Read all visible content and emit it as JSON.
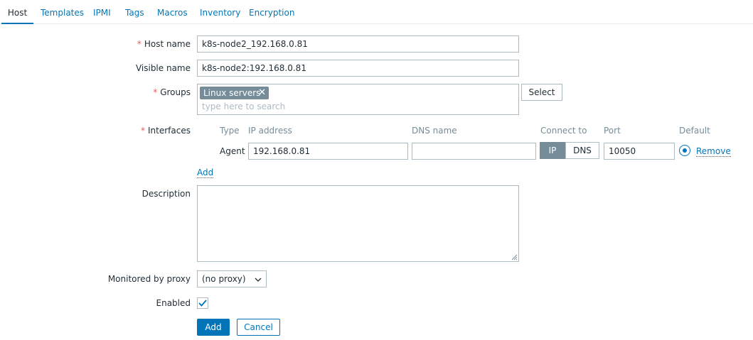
{
  "tabs": [
    {
      "label": "Host",
      "active": true
    },
    {
      "label": "Templates"
    },
    {
      "label": "IPMI"
    },
    {
      "label": "Tags"
    },
    {
      "label": "Macros"
    },
    {
      "label": "Inventory"
    },
    {
      "label": "Encryption"
    }
  ],
  "form": {
    "host_name": {
      "label": "Host name",
      "required": "*",
      "value": "k8s-node2_192.168.0.81"
    },
    "visible_name": {
      "label": "Visible name",
      "value": "k8s-node2:192.168.0.81"
    },
    "groups": {
      "label": "Groups",
      "required": "*",
      "chips": [
        "Linux servers"
      ],
      "placeholder": "type here to search",
      "select_label": "Select"
    },
    "interfaces": {
      "label": "Interfaces",
      "required": "*",
      "columns": {
        "type": "Type",
        "ip": "IP address",
        "dns": "DNS name",
        "connect": "Connect to",
        "port": "Port",
        "default": "Default"
      },
      "rows": [
        {
          "type": "Agent",
          "ip": "192.168.0.81",
          "dns": "",
          "connect_ip": "IP",
          "connect_dns": "DNS",
          "connect_selected": "IP",
          "port": "10050",
          "remove": "Remove"
        }
      ],
      "add_label": "Add"
    },
    "description": {
      "label": "Description",
      "value": ""
    },
    "proxy": {
      "label": "Monitored by proxy",
      "value": "(no proxy)"
    },
    "enabled": {
      "label": "Enabled",
      "checked": true
    }
  },
  "actions": {
    "add": "Add",
    "cancel": "Cancel"
  },
  "colors": {
    "accent": "#0275b8",
    "required": "#e45959",
    "chip": "#768d99",
    "border": "#acbbc2"
  },
  "icons": {
    "chip_remove": "close-icon",
    "select_arrow": "chevron-down-icon",
    "check": "check-icon",
    "resize": "resize-grip-icon"
  }
}
